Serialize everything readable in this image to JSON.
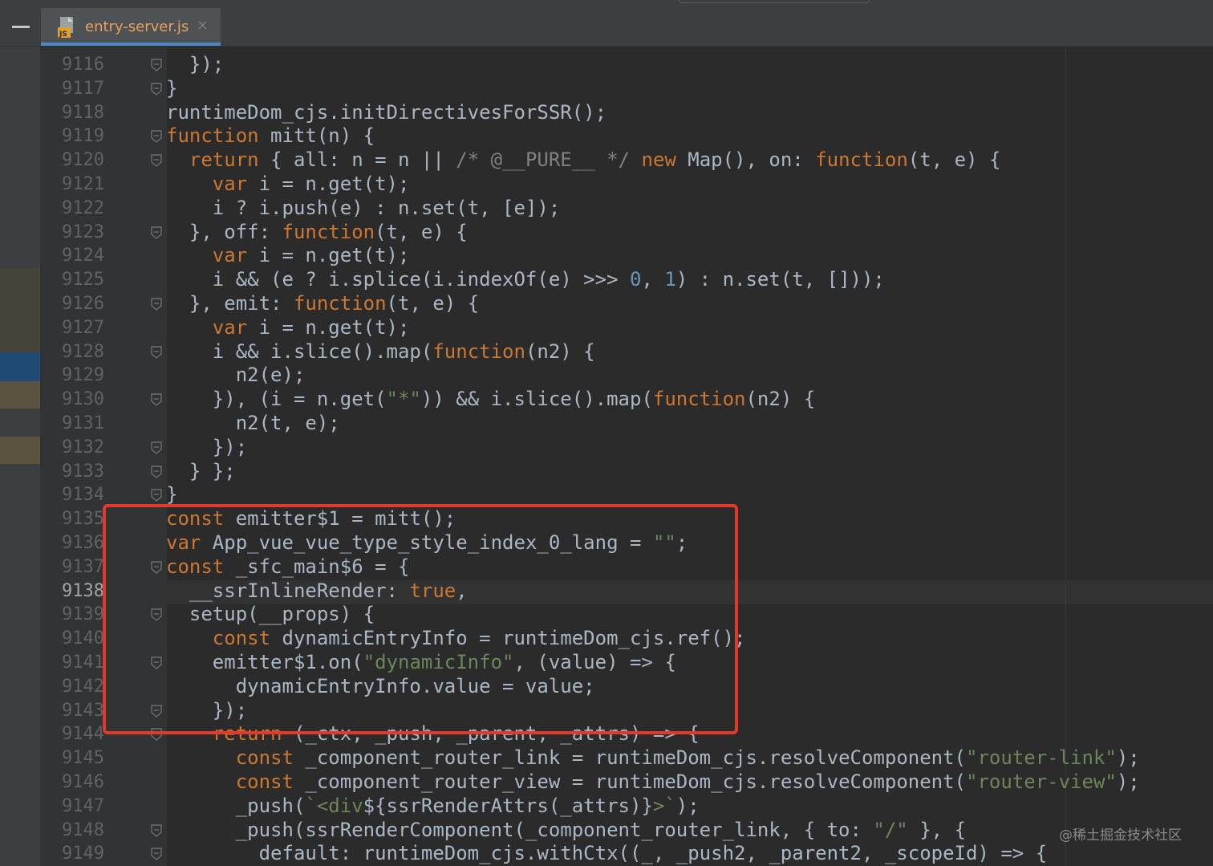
{
  "tab": {
    "filename": "entry-server.js",
    "close_glyph": "×",
    "icon": "js-file-icon"
  },
  "colors": {
    "keyword": "#cc7832",
    "string": "#6a8759",
    "number": "#6897bb",
    "comment": "#808080",
    "text": "#a9b7c6",
    "highlight_box": "#e3382c"
  },
  "line_numbers": [
    "9116",
    "9117",
    "9118",
    "9119",
    "9120",
    "9121",
    "9122",
    "9123",
    "9124",
    "9125",
    "9126",
    "9127",
    "9128",
    "9129",
    "9130",
    "9131",
    "9132",
    "9133",
    "9134",
    "9135",
    "9136",
    "9137",
    "9138",
    "9139",
    "9140",
    "9141",
    "9142",
    "9143",
    "9144",
    "9145",
    "9146",
    "9147",
    "9148",
    "9149"
  ],
  "current_line": "9138",
  "code": [
    [
      [
        "  });",
        "t"
      ]
    ],
    [
      [
        "}",
        "t"
      ]
    ],
    [
      [
        "runtimeDom_cjs.initDirectivesForSSR();",
        "t"
      ]
    ],
    [
      [
        "function",
        "k"
      ],
      [
        " mitt(n) {",
        "t"
      ]
    ],
    [
      [
        "  ",
        "t"
      ],
      [
        "return",
        "k"
      ],
      [
        " { all: n = n || ",
        "t"
      ],
      [
        "/* @__PURE__ */",
        "c"
      ],
      [
        " ",
        "t"
      ],
      [
        "new",
        "k"
      ],
      [
        " Map(), on: ",
        "t"
      ],
      [
        "function",
        "k"
      ],
      [
        "(t, e) {",
        "t"
      ]
    ],
    [
      [
        "    ",
        "t"
      ],
      [
        "var",
        "k"
      ],
      [
        " i = n.get(t);",
        "t"
      ]
    ],
    [
      [
        "    i ? i.push(e) : n.set(t, [e]);",
        "t"
      ]
    ],
    [
      [
        "  }, off: ",
        "t"
      ],
      [
        "function",
        "k"
      ],
      [
        "(t, e) {",
        "t"
      ]
    ],
    [
      [
        "    ",
        "t"
      ],
      [
        "var",
        "k"
      ],
      [
        " i = n.get(t);",
        "t"
      ]
    ],
    [
      [
        "    i && (e ? i.splice(i.indexOf(e) >>> ",
        "t"
      ],
      [
        "0",
        "n"
      ],
      [
        ", ",
        "t"
      ],
      [
        "1",
        "n"
      ],
      [
        ") : n.set(t, []));",
        "t"
      ]
    ],
    [
      [
        "  }, emit: ",
        "t"
      ],
      [
        "function",
        "k"
      ],
      [
        "(t, e) {",
        "t"
      ]
    ],
    [
      [
        "    ",
        "t"
      ],
      [
        "var",
        "k"
      ],
      [
        " i = n.get(t);",
        "t"
      ]
    ],
    [
      [
        "    i && i.slice().map(",
        "t"
      ],
      [
        "function",
        "k"
      ],
      [
        "(n2) {",
        "t"
      ]
    ],
    [
      [
        "      n2(e);",
        "t"
      ]
    ],
    [
      [
        "    }), (i = n.get(",
        "t"
      ],
      [
        "\"*\"",
        "s"
      ],
      [
        ")) && i.slice().map(",
        "t"
      ],
      [
        "function",
        "k"
      ],
      [
        "(n2) {",
        "t"
      ]
    ],
    [
      [
        "      n2(t, e);",
        "t"
      ]
    ],
    [
      [
        "    });",
        "t"
      ]
    ],
    [
      [
        "  } };",
        "t"
      ]
    ],
    [
      [
        "}",
        "t"
      ]
    ],
    [
      [
        "const",
        "k"
      ],
      [
        " emitter$1 = mitt();",
        "t"
      ]
    ],
    [
      [
        "var",
        "k"
      ],
      [
        " App_vue_vue_type_style_index_0_lang = ",
        "t"
      ],
      [
        "\"\"",
        "s"
      ],
      [
        ";",
        "t"
      ]
    ],
    [
      [
        "const",
        "k"
      ],
      [
        " _sfc_main$6 = {",
        "t"
      ]
    ],
    [
      [
        "  __ssrInlineRender: ",
        "t"
      ],
      [
        "true",
        "k"
      ],
      [
        ",",
        "t"
      ]
    ],
    [
      [
        "  setup(__props) {",
        "t"
      ]
    ],
    [
      [
        "    ",
        "t"
      ],
      [
        "const",
        "k"
      ],
      [
        " dynamicEntryInfo = runtimeDom_cjs.ref();",
        "t"
      ]
    ],
    [
      [
        "    emitter$1.on(",
        "t"
      ],
      [
        "\"dynamicInfo\"",
        "s"
      ],
      [
        ", (value) => {",
        "t"
      ]
    ],
    [
      [
        "      dynamicEntryInfo.value = value;",
        "t"
      ]
    ],
    [
      [
        "    });",
        "t"
      ]
    ],
    [
      [
        "    ",
        "t"
      ],
      [
        "return",
        "k"
      ],
      [
        " (_ctx, _push, _parent, _attrs) => {",
        "t"
      ]
    ],
    [
      [
        "      ",
        "t"
      ],
      [
        "const",
        "k"
      ],
      [
        " _component_router_link = runtimeDom_cjs.resolveComponent(",
        "t"
      ],
      [
        "\"router-link\"",
        "s"
      ],
      [
        ");",
        "t"
      ]
    ],
    [
      [
        "      ",
        "t"
      ],
      [
        "const",
        "k"
      ],
      [
        " _component_router_view = runtimeDom_cjs.resolveComponent(",
        "t"
      ],
      [
        "\"router-view\"",
        "s"
      ],
      [
        ");",
        "t"
      ]
    ],
    [
      [
        "      _push(",
        "t"
      ],
      [
        "`<div",
        "s"
      ],
      [
        "${ssrRenderAttrs(_attrs)}",
        "t"
      ],
      [
        ">`",
        "s"
      ],
      [
        ");",
        "t"
      ]
    ],
    [
      [
        "      _push(ssrRenderComponent(_component_router_link, { to: ",
        "t"
      ],
      [
        "\"/\"",
        "s"
      ],
      [
        " }, {",
        "t"
      ]
    ],
    [
      [
        "        default: runtimeDom_cjs.withCtx((_, _push2, _parent2, _scopeId) => {",
        "t"
      ]
    ]
  ],
  "watermark": "@稀土掘金技术社区"
}
